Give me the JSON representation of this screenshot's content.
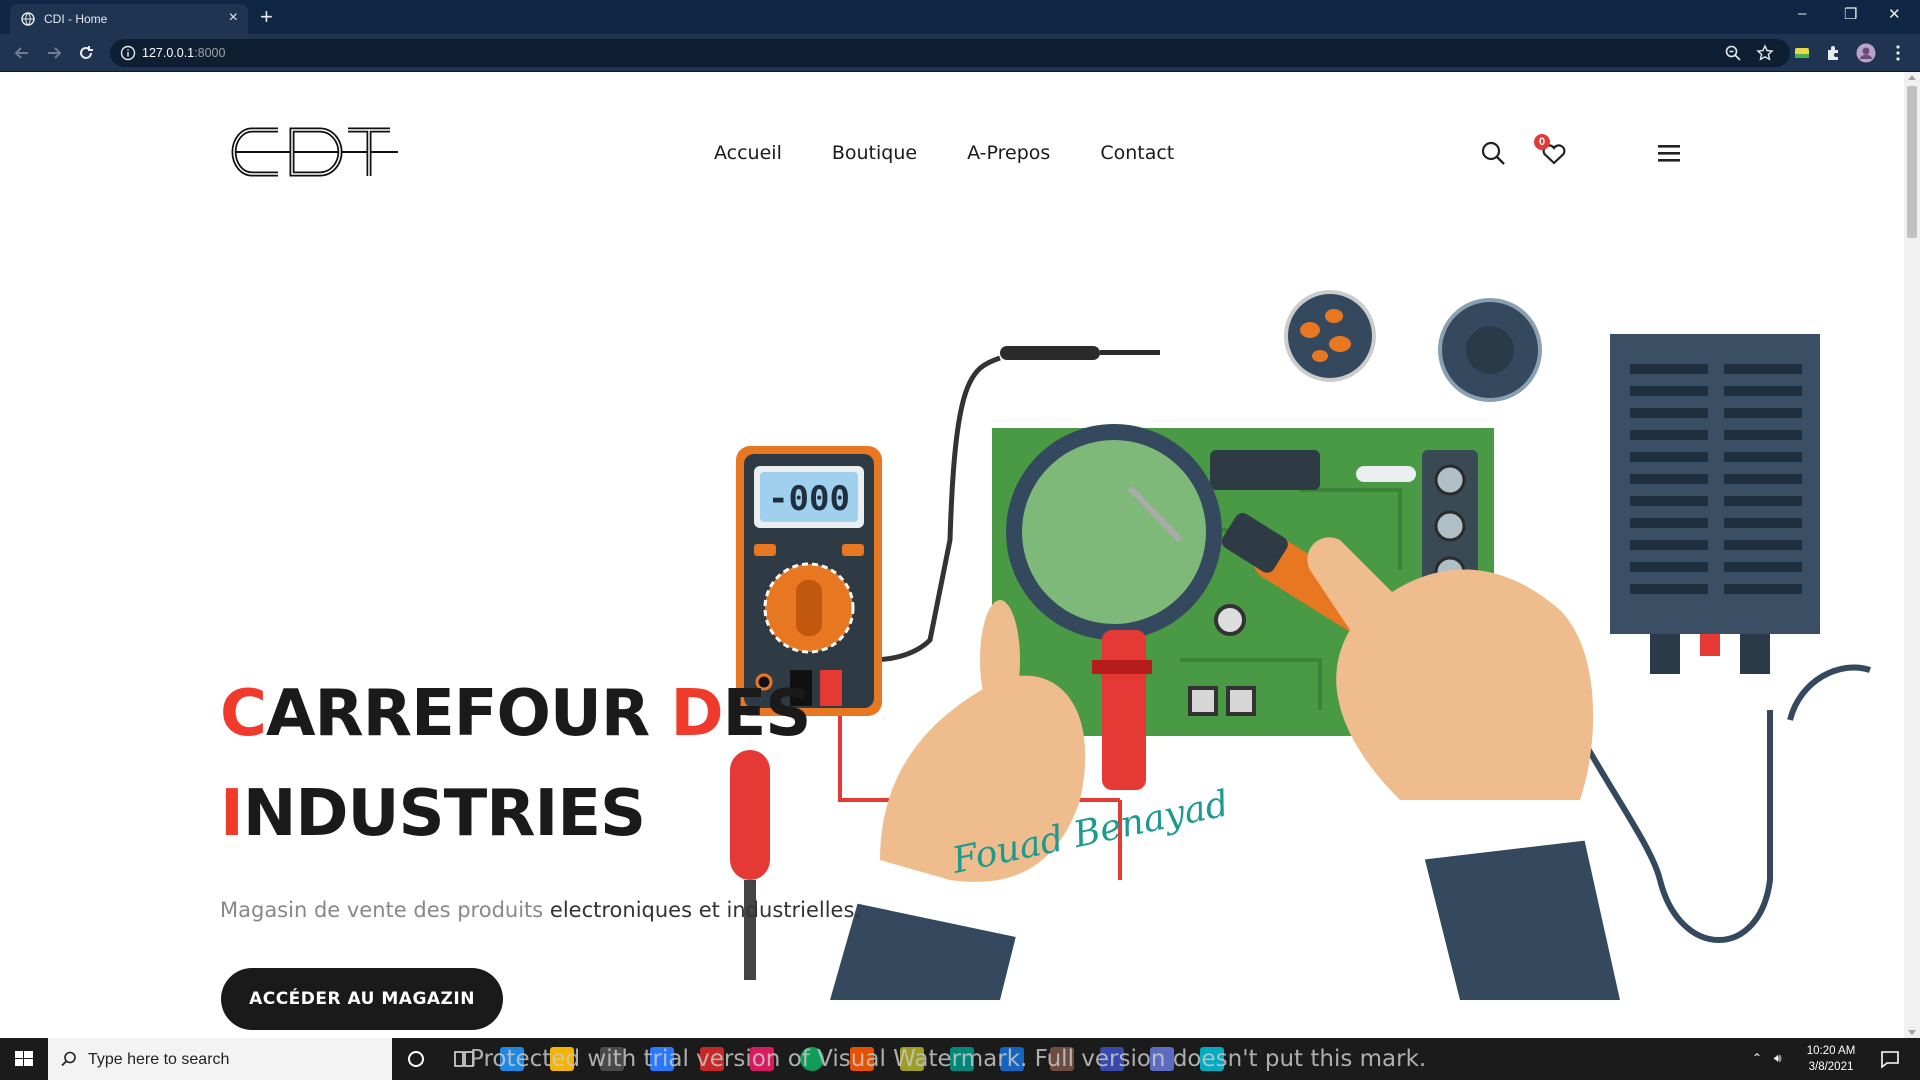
{
  "browser": {
    "tab_title": "CDI - Home",
    "new_tab": "+",
    "url_host": "127.0.0.1",
    "url_port": ":8000",
    "window_controls": [
      "–",
      "❐",
      "✕"
    ]
  },
  "header": {
    "logo_text": "CDI",
    "nav": [
      "Accueil",
      "Boutique",
      "A-Prepos",
      "Contact"
    ],
    "wishlist_count": "0",
    "icons": [
      "search-icon",
      "heart-icon",
      "hamburger-menu-icon"
    ]
  },
  "hero": {
    "title_line1": {
      "accent1": "C",
      "rest1": "ARREFOUR ",
      "accent2": "D",
      "rest2": "ES"
    },
    "title_line2": {
      "accent": "I",
      "rest": "NDUSTRIES"
    },
    "subtitle_light": "Magasin de vente des produits ",
    "subtitle_dark": "electroniques et industrielles.",
    "cta_label": "ACCÉDER AU MAGAZIN",
    "multimeter_display": "-000",
    "signature": "Fouad Benayad"
  },
  "taskbar": {
    "search_placeholder": "Type here to search",
    "watermark": "Protected with trial version of Visual Watermark. Full version doesn't put this mark.",
    "time": "10:20 AM",
    "date": "3/8/2021"
  },
  "colors": {
    "accent": "#f03a2c",
    "title": "#1a1a1a",
    "button": "#1a1a1a",
    "chrome": "#0f2744",
    "pcb": "#4a9a45",
    "navy": "#34495e",
    "orange": "#e87722"
  }
}
